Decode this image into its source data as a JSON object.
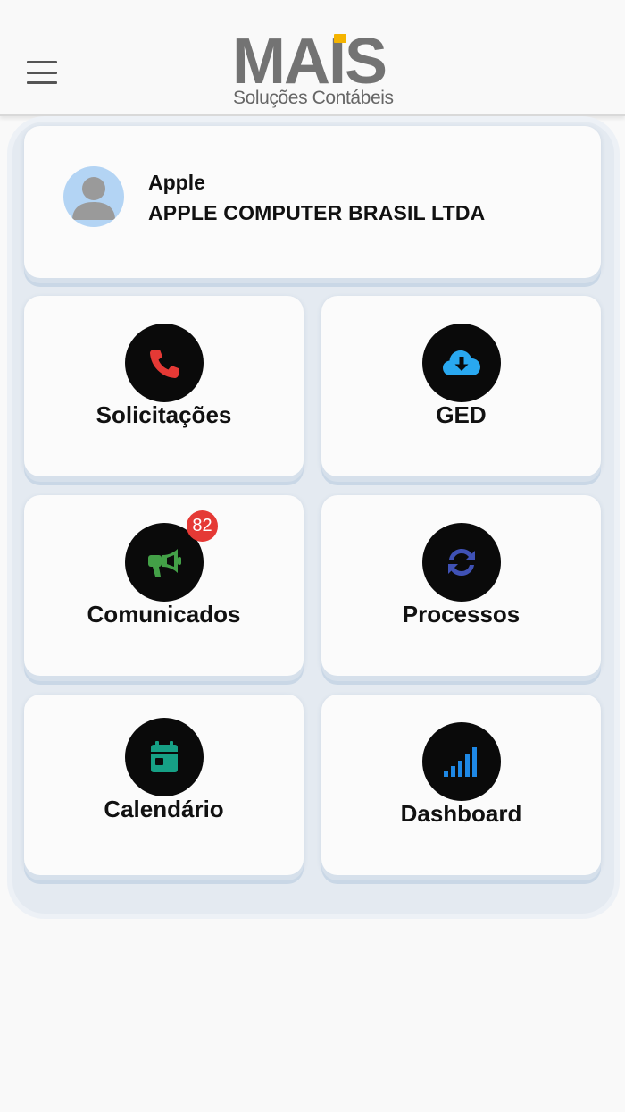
{
  "header": {
    "menu_icon": "hamburger-menu-icon",
    "logo_text": "MAIS",
    "logo_tagline": "Soluções Contábeis",
    "logo_accent_color": "#f5b400"
  },
  "profile": {
    "name": "Apple",
    "company": "APPLE COMPUTER BRASIL LTDA",
    "avatar_icon": "user-avatar-icon"
  },
  "tiles": [
    {
      "label": "Solicitações",
      "icon": "phone-icon",
      "icon_color": "#e53935"
    },
    {
      "label": "GED",
      "icon": "cloud-download-icon",
      "icon_color": "#29a8f0"
    },
    {
      "label": "Comunicados",
      "icon": "megaphone-icon",
      "icon_color": "#43a047",
      "badge": "82"
    },
    {
      "label": "Processos",
      "icon": "sync-icon",
      "icon_color": "#3f51b5"
    },
    {
      "label": "Calendário",
      "icon": "calendar-icon",
      "icon_color": "#16a085"
    },
    {
      "label": "Dashboard",
      "icon": "signal-bars-icon",
      "icon_color": "#1e88e5"
    }
  ]
}
